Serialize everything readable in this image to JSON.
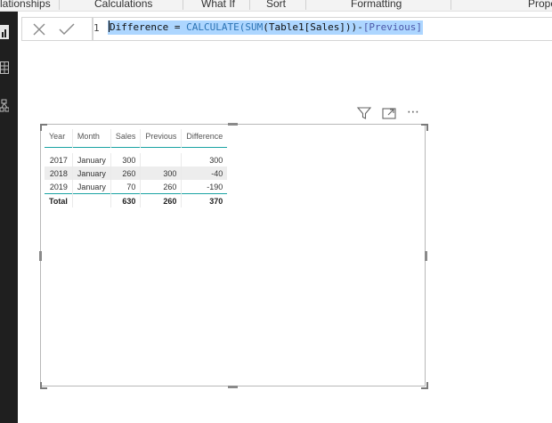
{
  "ribbon": {
    "tabs": [
      {
        "label": "lationships"
      },
      {
        "label": "Calculations"
      },
      {
        "label": "What If"
      },
      {
        "label": "Sort"
      },
      {
        "label": "Formatting"
      },
      {
        "label": "Prope"
      }
    ]
  },
  "formula_bar": {
    "line_number": "1",
    "measure_name": "Difference",
    "equals": " = ",
    "func_calculate": "CALCULATE",
    "paren_open": "(",
    "func_sum": "SUM",
    "args": "(Table1[Sales]))",
    "minus": "-",
    "measure_ref": "[Previous]"
  },
  "visual_header": {
    "icons": [
      "filter-icon",
      "focus-mode-icon",
      "more-options-icon"
    ],
    "more": "⋯"
  },
  "table": {
    "columns": [
      "Year",
      "Month",
      "Sales",
      "Previous",
      "Difference"
    ],
    "rows": [
      {
        "year": "2017",
        "month": "January",
        "sales": "300",
        "previous": "",
        "difference": "300"
      },
      {
        "year": "2018",
        "month": "January",
        "sales": "260",
        "previous": "300",
        "difference": "-40"
      },
      {
        "year": "2019",
        "month": "January",
        "sales": "70",
        "previous": "260",
        "difference": "-190"
      }
    ],
    "total": {
      "label": "Total",
      "sales": "630",
      "previous": "260",
      "difference": "370"
    },
    "accent_color": "#1aa3a3"
  }
}
